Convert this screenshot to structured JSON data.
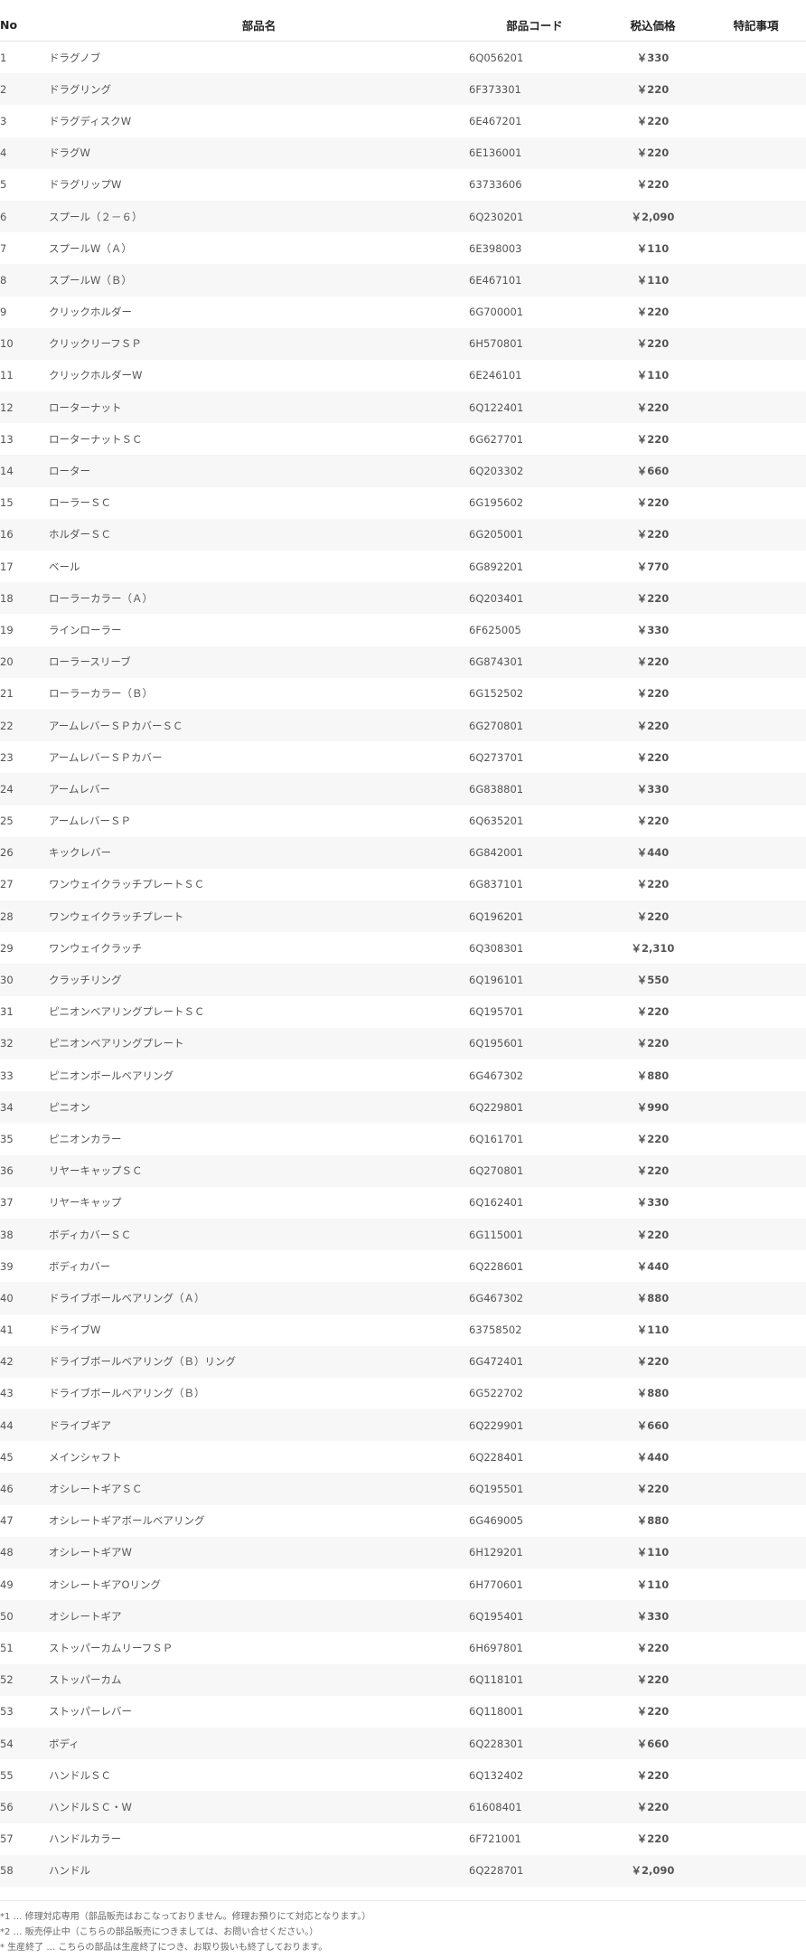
{
  "headers": {
    "no": "No",
    "name": "部品名",
    "code": "部品コード",
    "price": "税込価格",
    "note": "特記事項"
  },
  "rows": [
    {
      "no": "1",
      "name": "ドラグノブ",
      "code": "6Q056201",
      "price": "￥330",
      "note": ""
    },
    {
      "no": "2",
      "name": "ドラグリング",
      "code": "6F373301",
      "price": "￥220",
      "note": ""
    },
    {
      "no": "3",
      "name": "ドラグディスクW",
      "code": "6E467201",
      "price": "￥220",
      "note": ""
    },
    {
      "no": "4",
      "name": "ドラグW",
      "code": "6E136001",
      "price": "￥220",
      "note": ""
    },
    {
      "no": "5",
      "name": "ドラグリップW",
      "code": "63733606",
      "price": "￥220",
      "note": ""
    },
    {
      "no": "6",
      "name": "スプール（２－６）",
      "code": "6Q230201",
      "price": "￥2,090",
      "note": ""
    },
    {
      "no": "7",
      "name": "スプールW（Ａ）",
      "code": "6E398003",
      "price": "￥110",
      "note": ""
    },
    {
      "no": "8",
      "name": "スプールW（Ｂ）",
      "code": "6E467101",
      "price": "￥110",
      "note": ""
    },
    {
      "no": "9",
      "name": "クリックホルダー",
      "code": "6G700001",
      "price": "￥220",
      "note": ""
    },
    {
      "no": "10",
      "name": "クリックリーフＳＰ",
      "code": "6H570801",
      "price": "￥220",
      "note": ""
    },
    {
      "no": "11",
      "name": "クリックホルダーW",
      "code": "6E246101",
      "price": "￥110",
      "note": ""
    },
    {
      "no": "12",
      "name": "ローターナット",
      "code": "6Q122401",
      "price": "￥220",
      "note": ""
    },
    {
      "no": "13",
      "name": "ローターナットＳＣ",
      "code": "6G627701",
      "price": "￥220",
      "note": ""
    },
    {
      "no": "14",
      "name": "ローター",
      "code": "6Q203302",
      "price": "￥660",
      "note": ""
    },
    {
      "no": "15",
      "name": "ローラーＳＣ",
      "code": "6G195602",
      "price": "￥220",
      "note": ""
    },
    {
      "no": "16",
      "name": "ホルダーＳＣ",
      "code": "6G205001",
      "price": "￥220",
      "note": ""
    },
    {
      "no": "17",
      "name": "ベール",
      "code": "6G892201",
      "price": "￥770",
      "note": ""
    },
    {
      "no": "18",
      "name": "ローラーカラー（Ａ）",
      "code": "6Q203401",
      "price": "￥220",
      "note": ""
    },
    {
      "no": "19",
      "name": "ラインローラー",
      "code": "6F625005",
      "price": "￥330",
      "note": ""
    },
    {
      "no": "20",
      "name": "ローラースリーブ",
      "code": "6G874301",
      "price": "￥220",
      "note": ""
    },
    {
      "no": "21",
      "name": "ローラーカラー（Ｂ）",
      "code": "6G152502",
      "price": "￥220",
      "note": ""
    },
    {
      "no": "22",
      "name": "アームレバーＳＰカバーＳＣ",
      "code": "6G270801",
      "price": "￥220",
      "note": ""
    },
    {
      "no": "23",
      "name": "アームレバーＳＰカバー",
      "code": "6Q273701",
      "price": "￥220",
      "note": ""
    },
    {
      "no": "24",
      "name": "アームレバー",
      "code": "6G838801",
      "price": "￥330",
      "note": ""
    },
    {
      "no": "25",
      "name": "アームレバーＳＰ",
      "code": "6Q635201",
      "price": "￥220",
      "note": ""
    },
    {
      "no": "26",
      "name": "キックレバー",
      "code": "6G842001",
      "price": "￥440",
      "note": ""
    },
    {
      "no": "27",
      "name": "ワンウェイクラッチプレートＳＣ",
      "code": "6G837101",
      "price": "￥220",
      "note": ""
    },
    {
      "no": "28",
      "name": "ワンウェイクラッチプレート",
      "code": "6Q196201",
      "price": "￥220",
      "note": ""
    },
    {
      "no": "29",
      "name": "ワンウェイクラッチ",
      "code": "6Q308301",
      "price": "￥2,310",
      "note": ""
    },
    {
      "no": "30",
      "name": "クラッチリング",
      "code": "6Q196101",
      "price": "￥550",
      "note": ""
    },
    {
      "no": "31",
      "name": "ピニオンベアリングプレートＳＣ",
      "code": "6Q195701",
      "price": "￥220",
      "note": ""
    },
    {
      "no": "32",
      "name": "ピニオンベアリングプレート",
      "code": "6Q195601",
      "price": "￥220",
      "note": ""
    },
    {
      "no": "33",
      "name": "ピニオンボールベアリング",
      "code": "6G467302",
      "price": "￥880",
      "note": ""
    },
    {
      "no": "34",
      "name": "ピニオン",
      "code": "6Q229801",
      "price": "￥990",
      "note": ""
    },
    {
      "no": "35",
      "name": "ピニオンカラー",
      "code": "6Q161701",
      "price": "￥220",
      "note": ""
    },
    {
      "no": "36",
      "name": "リヤーキャップＳＣ",
      "code": "6Q270801",
      "price": "￥220",
      "note": ""
    },
    {
      "no": "37",
      "name": "リヤーキャップ",
      "code": "6Q162401",
      "price": "￥330",
      "note": ""
    },
    {
      "no": "38",
      "name": "ボディカバーＳＣ",
      "code": "6G115001",
      "price": "￥220",
      "note": ""
    },
    {
      "no": "39",
      "name": "ボディカバー",
      "code": "6Q228601",
      "price": "￥440",
      "note": ""
    },
    {
      "no": "40",
      "name": "ドライブボールベアリング（Ａ）",
      "code": "6G467302",
      "price": "￥880",
      "note": ""
    },
    {
      "no": "41",
      "name": "ドライブW",
      "code": "63758502",
      "price": "￥110",
      "note": ""
    },
    {
      "no": "42",
      "name": "ドライブボールベアリング（Ｂ）リング",
      "code": "6G472401",
      "price": "￥220",
      "note": ""
    },
    {
      "no": "43",
      "name": "ドライブボールベアリング（Ｂ）",
      "code": "6G522702",
      "price": "￥880",
      "note": ""
    },
    {
      "no": "44",
      "name": "ドライブギア",
      "code": "6Q229901",
      "price": "￥660",
      "note": ""
    },
    {
      "no": "45",
      "name": "メインシャフト",
      "code": "6Q228401",
      "price": "￥440",
      "note": ""
    },
    {
      "no": "46",
      "name": "オシレートギアＳＣ",
      "code": "6Q195501",
      "price": "￥220",
      "note": ""
    },
    {
      "no": "47",
      "name": "オシレートギアボールベアリング",
      "code": "6G469005",
      "price": "￥880",
      "note": ""
    },
    {
      "no": "48",
      "name": "オシレートギアW",
      "code": "6H129201",
      "price": "￥110",
      "note": ""
    },
    {
      "no": "49",
      "name": "オシレートギアOリング",
      "code": "6H770601",
      "price": "￥110",
      "note": ""
    },
    {
      "no": "50",
      "name": "オシレートギア",
      "code": "6Q195401",
      "price": "￥330",
      "note": ""
    },
    {
      "no": "51",
      "name": "ストッパーカムリーフＳＰ",
      "code": "6H697801",
      "price": "￥220",
      "note": ""
    },
    {
      "no": "52",
      "name": "ストッパーカム",
      "code": "6Q118101",
      "price": "￥220",
      "note": ""
    },
    {
      "no": "53",
      "name": "ストッパーレバー",
      "code": "6Q118001",
      "price": "￥220",
      "note": ""
    },
    {
      "no": "54",
      "name": "ボディ",
      "code": "6Q228301",
      "price": "￥660",
      "note": ""
    },
    {
      "no": "55",
      "name": "ハンドルＳＣ",
      "code": "6Q132402",
      "price": "￥220",
      "note": ""
    },
    {
      "no": "56",
      "name": "ハンドルＳＣ・W",
      "code": "61608401",
      "price": "￥220",
      "note": ""
    },
    {
      "no": "57",
      "name": "ハンドルカラー",
      "code": "6F721001",
      "price": "￥220",
      "note": ""
    },
    {
      "no": "58",
      "name": "ハンドル",
      "code": "6Q228701",
      "price": "￥2,090",
      "note": ""
    }
  ],
  "footnotes": [
    "*1 … 修理対応専用（部品販売はおこなっておりません。修理お預りにて対応となります。）",
    "*2 … 販売停止中（こちらの部品販売につきましては、お問い合せください。）",
    "* 生産終了 … こちらの部品は生産終了につき、お取り扱いも終了しております。"
  ]
}
